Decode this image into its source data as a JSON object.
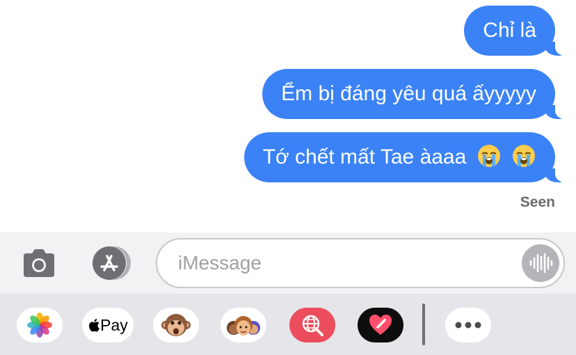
{
  "messages": [
    {
      "text": "Chỉ là",
      "from": "me"
    },
    {
      "text": "Ểm bị đáng yêu quá ấyyyyy",
      "from": "me"
    },
    {
      "text": "Tớ chết mất Tae àaaa",
      "from": "me",
      "trailing_emoji": [
        "loudly-crying-face",
        "loudly-crying-face"
      ]
    }
  ],
  "status": {
    "read_receipt": "Seen"
  },
  "input": {
    "placeholder": "iMessage",
    "value": ""
  },
  "apps": {
    "pay_label": "Pay",
    "items": [
      "photos",
      "apple-pay",
      "animoji",
      "memoji",
      "web-search",
      "digital-touch",
      "more"
    ]
  },
  "colors": {
    "bubble": "#3b82f6",
    "search_app": "#ec4d5c",
    "heart_app": "#0d0d0d"
  }
}
